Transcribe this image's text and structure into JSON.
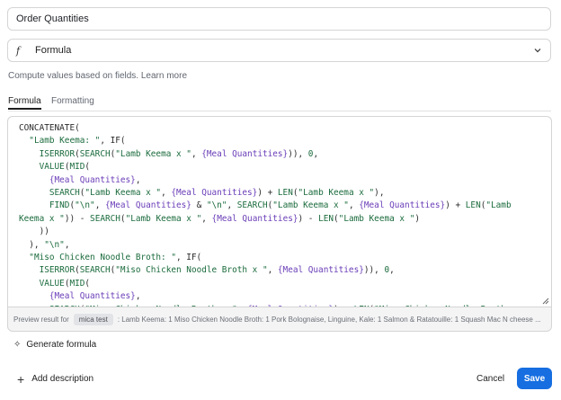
{
  "field": {
    "name": "Order Quantities"
  },
  "type_select": {
    "icon": "function-icon",
    "glyph": "𝑓",
    "value": "Formula"
  },
  "help": {
    "text": "Compute values based on fields.",
    "link": "Learn more"
  },
  "tabs": [
    {
      "label": "Formula",
      "active": true
    },
    {
      "label": "Formatting",
      "active": false
    }
  ],
  "editor": {
    "lines": [
      [
        [
          "p",
          "CONCATENATE("
        ]
      ],
      [
        [
          "p",
          "  "
        ],
        [
          "s",
          "\"Lamb Keema: \""
        ],
        [
          "p",
          ", IF("
        ]
      ],
      [
        [
          "p",
          "    "
        ],
        [
          "f",
          "ISERROR"
        ],
        [
          "p",
          "("
        ],
        [
          "f",
          "SEARCH"
        ],
        [
          "p",
          "("
        ],
        [
          "s",
          "\"Lamb Keema x \""
        ],
        [
          "p",
          ", "
        ],
        [
          "r",
          "{Meal Quantities}"
        ],
        [
          "p",
          ")), "
        ],
        [
          "n",
          "0"
        ],
        [
          "p",
          ","
        ]
      ],
      [
        [
          "p",
          "    "
        ],
        [
          "f",
          "VALUE"
        ],
        [
          "p",
          "("
        ],
        [
          "f",
          "MID"
        ],
        [
          "p",
          "("
        ]
      ],
      [
        [
          "p",
          "      "
        ],
        [
          "r",
          "{Meal Quantities}"
        ],
        [
          "p",
          ","
        ]
      ],
      [
        [
          "p",
          "      "
        ],
        [
          "f",
          "SEARCH"
        ],
        [
          "p",
          "("
        ],
        [
          "s",
          "\"Lamb Keema x \""
        ],
        [
          "p",
          ", "
        ],
        [
          "r",
          "{Meal Quantities}"
        ],
        [
          "p",
          ") + "
        ],
        [
          "f",
          "LEN"
        ],
        [
          "p",
          "("
        ],
        [
          "s",
          "\"Lamb Keema x \""
        ],
        [
          "p",
          "),"
        ]
      ],
      [
        [
          "p",
          "      "
        ],
        [
          "f",
          "FIND"
        ],
        [
          "p",
          "("
        ],
        [
          "s",
          "\"\\n\""
        ],
        [
          "p",
          ", "
        ],
        [
          "r",
          "{Meal Quantities}"
        ],
        [
          "p",
          " & "
        ],
        [
          "s",
          "\"\\n\""
        ],
        [
          "p",
          ", "
        ],
        [
          "f",
          "SEARCH"
        ],
        [
          "p",
          "("
        ],
        [
          "s",
          "\"Lamb Keema x \""
        ],
        [
          "p",
          ", "
        ],
        [
          "r",
          "{Meal Quantities}"
        ],
        [
          "p",
          ") + "
        ],
        [
          "f",
          "LEN"
        ],
        [
          "p",
          "("
        ],
        [
          "s",
          "\"Lamb"
        ]
      ],
      [
        [
          "s",
          "Keema x \""
        ],
        [
          "p",
          ")) - "
        ],
        [
          "f",
          "SEARCH"
        ],
        [
          "p",
          "("
        ],
        [
          "s",
          "\"Lamb Keema x \""
        ],
        [
          "p",
          ", "
        ],
        [
          "r",
          "{Meal Quantities}"
        ],
        [
          "p",
          ") - "
        ],
        [
          "f",
          "LEN"
        ],
        [
          "p",
          "("
        ],
        [
          "s",
          "\"Lamb Keema x \""
        ],
        [
          "p",
          ")"
        ]
      ],
      [
        [
          "p",
          "    ))"
        ]
      ],
      [
        [
          "p",
          "  ), "
        ],
        [
          "s",
          "\"\\n\""
        ],
        [
          "p",
          ","
        ]
      ],
      [
        [
          "p",
          "  "
        ],
        [
          "s",
          "\"Miso Chicken Noodle Broth: \""
        ],
        [
          "p",
          ", IF("
        ]
      ],
      [
        [
          "p",
          "    "
        ],
        [
          "f",
          "ISERROR"
        ],
        [
          "p",
          "("
        ],
        [
          "f",
          "SEARCH"
        ],
        [
          "p",
          "("
        ],
        [
          "s",
          "\"Miso Chicken Noodle Broth x \""
        ],
        [
          "p",
          ", "
        ],
        [
          "r",
          "{Meal Quantities}"
        ],
        [
          "p",
          ")), "
        ],
        [
          "n",
          "0"
        ],
        [
          "p",
          ","
        ]
      ],
      [
        [
          "p",
          "    "
        ],
        [
          "f",
          "VALUE"
        ],
        [
          "p",
          "("
        ],
        [
          "f",
          "MID"
        ],
        [
          "p",
          "("
        ]
      ],
      [
        [
          "p",
          "      "
        ],
        [
          "r",
          "{Meal Quantities}"
        ],
        [
          "p",
          ","
        ]
      ],
      [
        [
          "p",
          "      "
        ],
        [
          "f",
          "SEARCH"
        ],
        [
          "p",
          "("
        ],
        [
          "s",
          "\"Miso Chicken Noodle Broth x \""
        ],
        [
          "p",
          ", "
        ],
        [
          "r",
          "{Meal Quantities}"
        ],
        [
          "p",
          ") + "
        ],
        [
          "f",
          "LEN"
        ],
        [
          "p",
          "("
        ],
        [
          "s",
          "\"Miso Chicken Noodle Broth x"
        ]
      ]
    ]
  },
  "preview": {
    "label": "Preview result for",
    "record": "mica test",
    "result": ": Lamb Keema: 1 Miso Chicken Noodle Broth: 1 Pork Bolognaise, Linguine, Kale: 1 Salmon & Ratatouille: 1 Squash Mac N cheese ..."
  },
  "generate": {
    "label": "Generate formula"
  },
  "footer": {
    "add_description": "Add description",
    "cancel": "Cancel",
    "save": "Save"
  },
  "colors": {
    "accent": "#166ee1",
    "string": "#1a6b3c",
    "field_ref": "#6a3db8"
  }
}
